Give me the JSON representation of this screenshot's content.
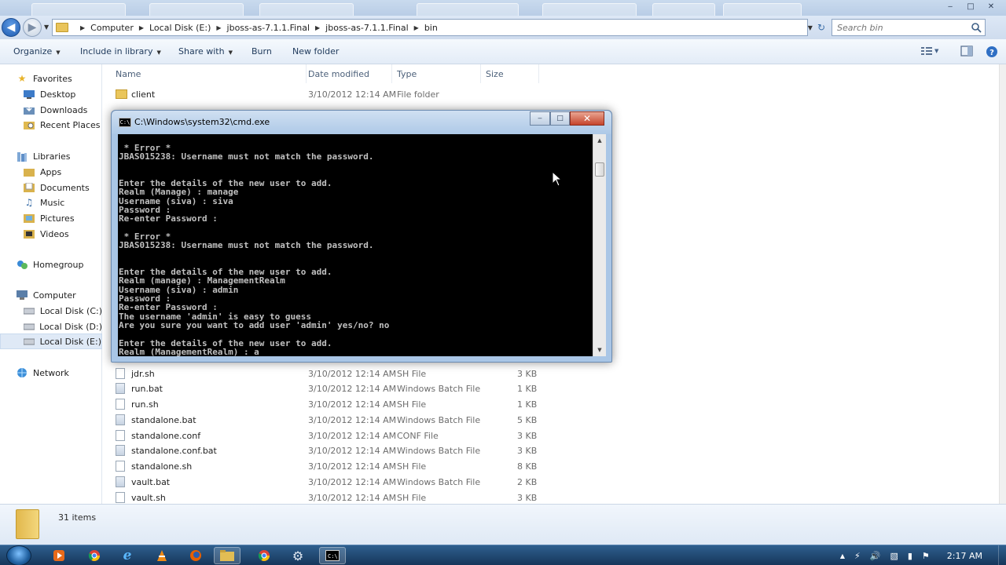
{
  "window": {
    "minimize_glyph": "‒",
    "maximize_glyph": "□",
    "close_glyph": "✕"
  },
  "address": {
    "crumbs": [
      "Computer",
      "Local Disk (E:)",
      "jboss-as-7.1.1.Final",
      "jboss-as-7.1.1.Final",
      "bin"
    ],
    "search_placeholder": "Search bin"
  },
  "toolbar": {
    "organize": "Organize",
    "include_in_library": "Include in library",
    "share_with": "Share with",
    "burn": "Burn",
    "new_folder": "New folder"
  },
  "sidebar": {
    "favorites": "Favorites",
    "desktop": "Desktop",
    "downloads": "Downloads",
    "recent_places": "Recent Places",
    "libraries": "Libraries",
    "apps": "Apps",
    "documents": "Documents",
    "music": "Music",
    "pictures": "Pictures",
    "videos": "Videos",
    "homegroup": "Homegroup",
    "computer": "Computer",
    "disk_c": "Local Disk (C:)",
    "disk_d": "Local Disk (D:)",
    "disk_e": "Local Disk (E:)",
    "network": "Network"
  },
  "columns": {
    "name": "Name",
    "date_modified": "Date modified",
    "type": "Type",
    "size": "Size"
  },
  "files": [
    {
      "name": "client",
      "date": "3/10/2012 12:14 AM",
      "type": "File folder",
      "size": "",
      "icon": "folder"
    },
    {
      "name": "jdr.sh",
      "date": "3/10/2012 12:14 AM",
      "type": "SH File",
      "size": "3 KB",
      "icon": "file"
    },
    {
      "name": "run.bat",
      "date": "3/10/2012 12:14 AM",
      "type": "Windows Batch File",
      "size": "1 KB",
      "icon": "bat"
    },
    {
      "name": "run.sh",
      "date": "3/10/2012 12:14 AM",
      "type": "SH File",
      "size": "1 KB",
      "icon": "file"
    },
    {
      "name": "standalone.bat",
      "date": "3/10/2012 12:14 AM",
      "type": "Windows Batch File",
      "size": "5 KB",
      "icon": "bat"
    },
    {
      "name": "standalone.conf",
      "date": "3/10/2012 12:14 AM",
      "type": "CONF File",
      "size": "3 KB",
      "icon": "file"
    },
    {
      "name": "standalone.conf.bat",
      "date": "3/10/2012 12:14 AM",
      "type": "Windows Batch File",
      "size": "3 KB",
      "icon": "bat"
    },
    {
      "name": "standalone.sh",
      "date": "3/10/2012 12:14 AM",
      "type": "SH File",
      "size": "8 KB",
      "icon": "file"
    },
    {
      "name": "vault.bat",
      "date": "3/10/2012 12:14 AM",
      "type": "Windows Batch File",
      "size": "2 KB",
      "icon": "bat"
    },
    {
      "name": "vault.sh",
      "date": "3/10/2012 12:14 AM",
      "type": "SH File",
      "size": "3 KB",
      "icon": "file"
    }
  ],
  "status": {
    "item_count": "31 items"
  },
  "cmd": {
    "title": "C:\\Windows\\system32\\cmd.exe",
    "output": " * Error *\nJBAS015238: Username must not match the password.\n\n\nEnter the details of the new user to add.\nRealm (Manage) : manage\nUsername (siva) : siva\nPassword :\nRe-enter Password :\n\n * Error *\nJBAS015238: Username must not match the password.\n\n\nEnter the details of the new user to add.\nRealm (manage) : ManagementRealm\nUsername (siva) : admin\nPassword :\nRe-enter Password :\nThe username 'admin' is easy to guess\nAre you sure you want to add user 'admin' yes/no? no\n\nEnter the details of the new user to add.\nRealm (ManagementRealm) : a"
  },
  "taskbar": {
    "clock": "2:17 AM"
  },
  "colors": {
    "accent": "#1e5bb0",
    "console_bg": "#000000",
    "console_fg": "#c0c0c0",
    "taskbar": "#1f4670"
  }
}
